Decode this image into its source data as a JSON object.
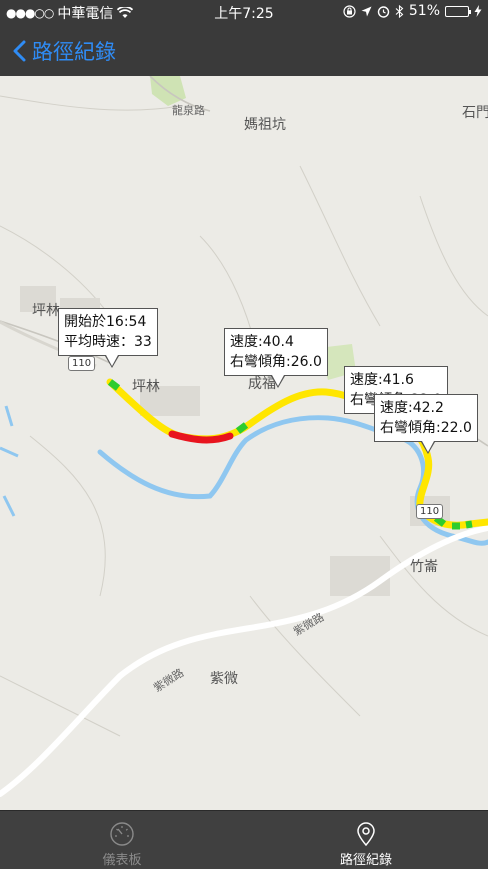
{
  "status": {
    "carrier": "中華電信",
    "time": "上午7:25",
    "battery": "51%",
    "battery_level": 0.51
  },
  "nav": {
    "back_label": "路徑紀錄"
  },
  "map": {
    "places": [
      "龍泉路",
      "媽祖坑",
      "石門",
      "坪林",
      "坪林",
      "成福",
      "竹崙",
      "紫微路",
      "紫微路",
      "紫微"
    ],
    "shields": [
      "110",
      "110"
    ]
  },
  "callouts": [
    {
      "line1": "開始於16:54",
      "line2": "平均時速：33"
    },
    {
      "line1": "速度:40.4",
      "line2": "右彎傾角:26.0"
    },
    {
      "line1": "速度:41.6",
      "line2": "右彎傾角:22.0"
    },
    {
      "line1": "速度:42.2",
      "line2": "右彎傾角:22.0"
    }
  ],
  "tabs": [
    {
      "label": "儀表板"
    },
    {
      "label": "路徑紀錄"
    }
  ],
  "colors": {
    "accent": "#2f8cf5",
    "route_normal": "#ffe600",
    "route_slow": "#e8141e",
    "route_marker": "#2ecc2e",
    "river": "#8fc7f0"
  }
}
